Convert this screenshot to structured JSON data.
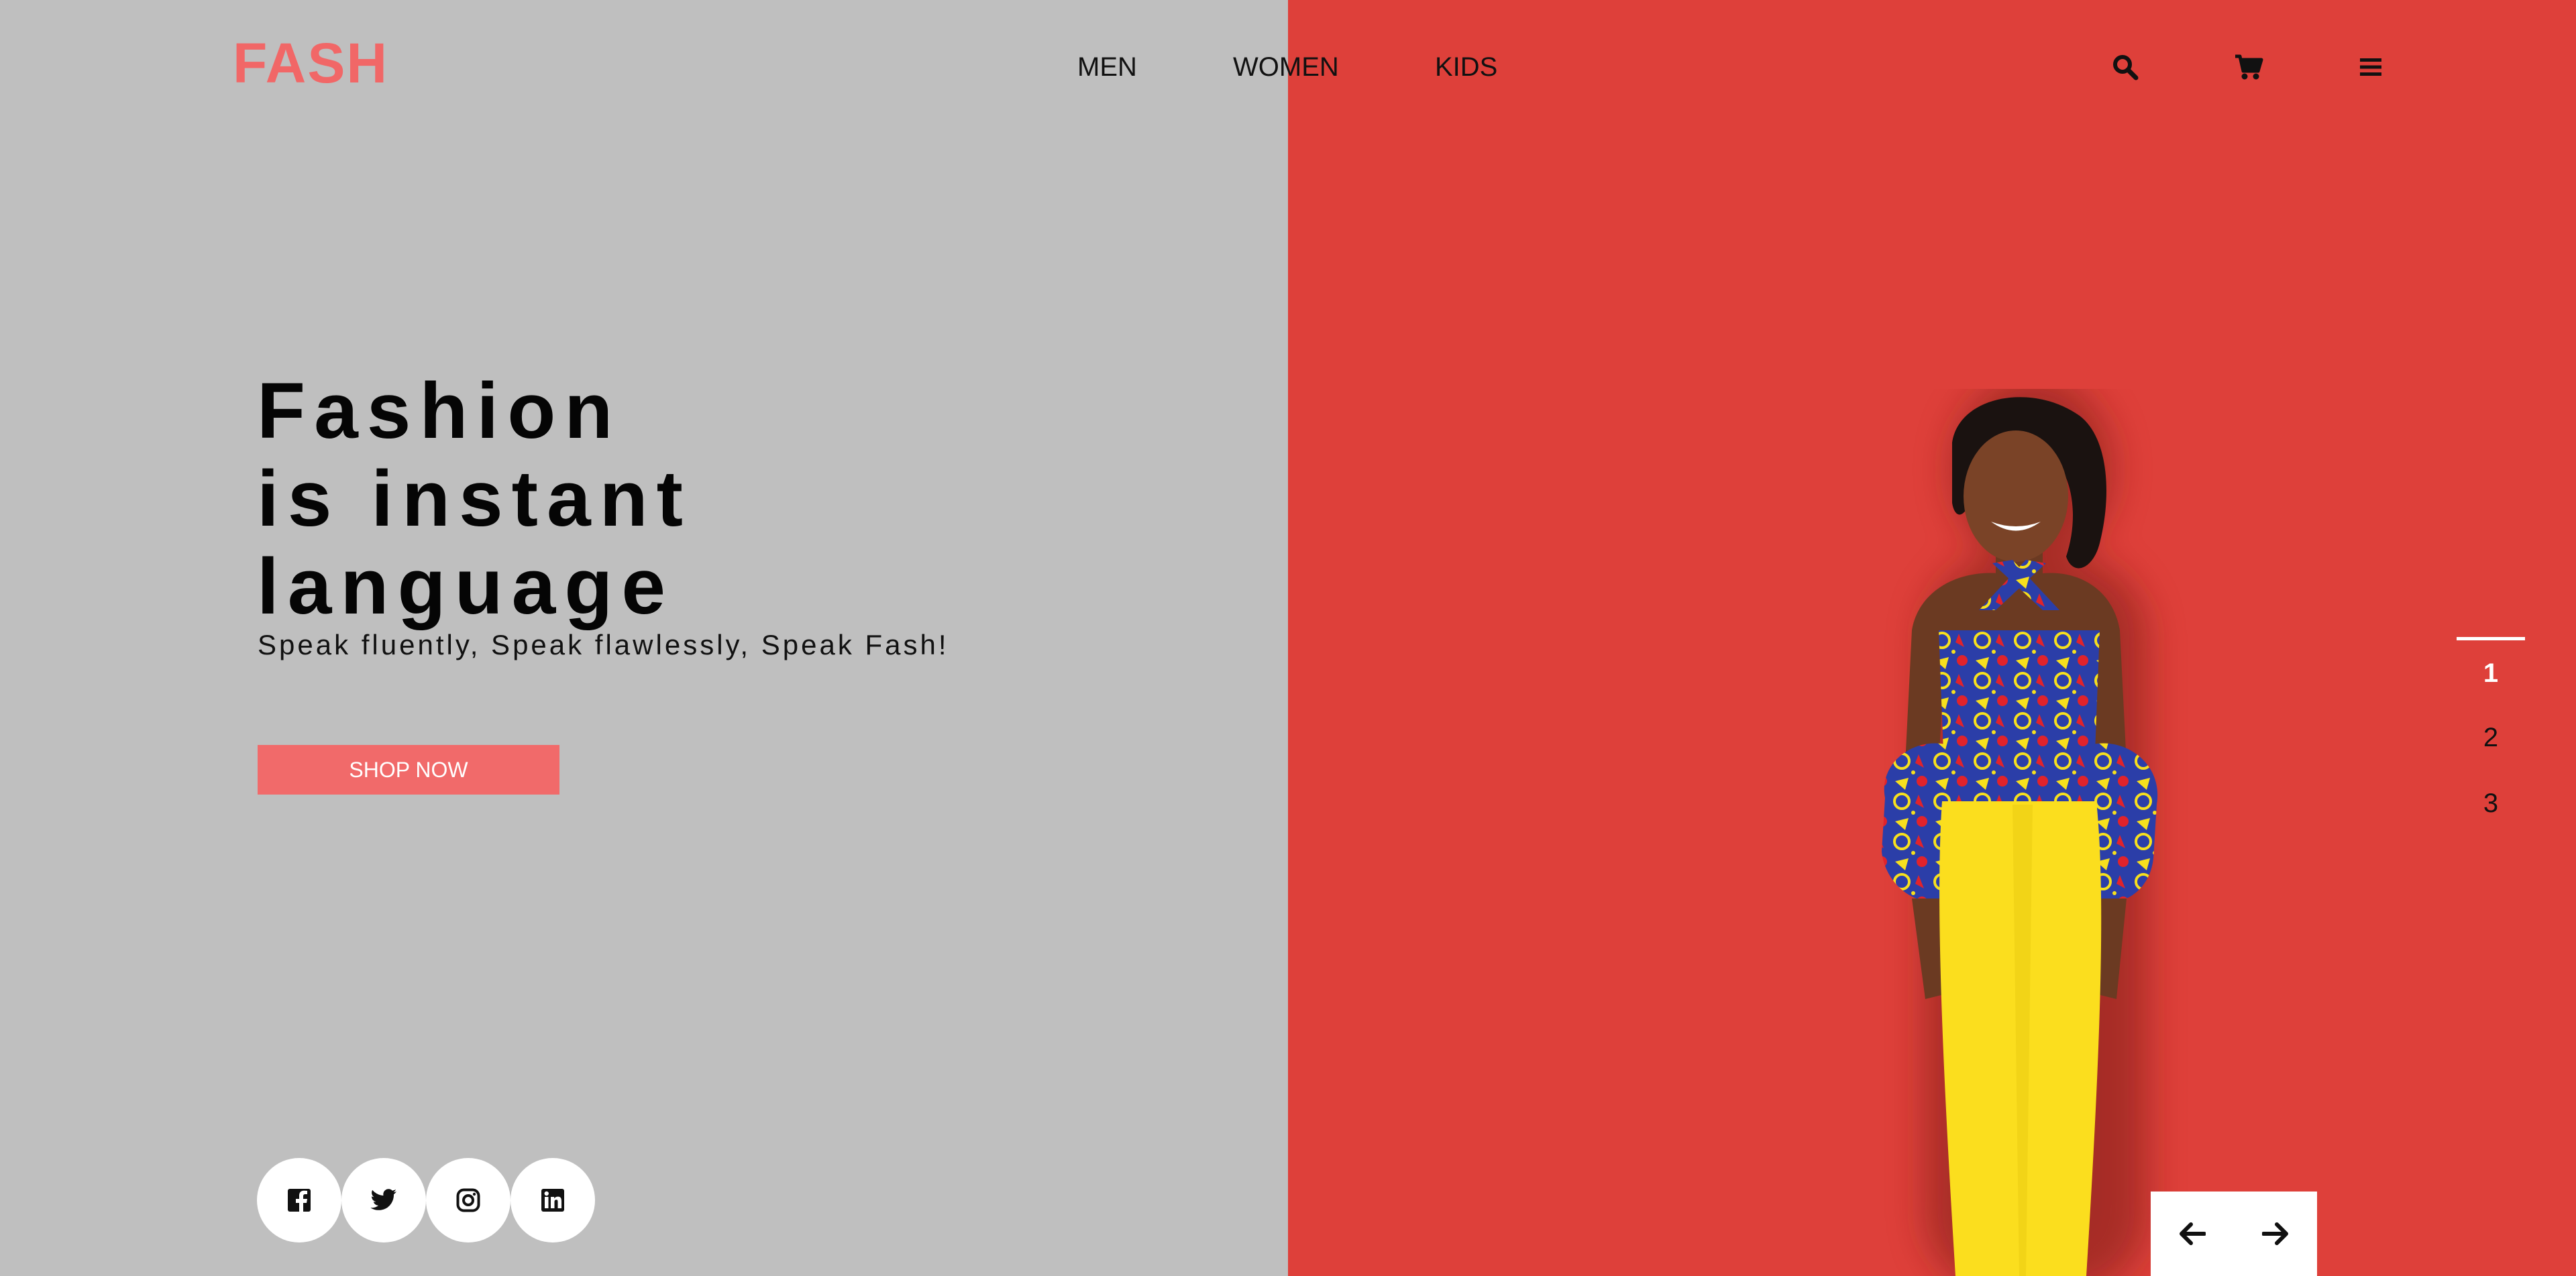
{
  "header": {
    "logo": "FASH",
    "nav": [
      {
        "label": "MEN"
      },
      {
        "label": "WOMEN"
      },
      {
        "label": "KIDS"
      }
    ],
    "icons": [
      "search-icon",
      "cart-icon",
      "menu-icon"
    ]
  },
  "hero": {
    "title_lines": [
      "Fashion",
      "is instant",
      "language"
    ],
    "subtitle": "Speak fluently, Speak flawlessly, Speak Fash!",
    "cta_label": "SHOP NOW"
  },
  "social": [
    "facebook-icon",
    "twitter-icon",
    "instagram-icon",
    "linkedin-icon"
  ],
  "slider": {
    "pages": [
      "1",
      "2",
      "3"
    ],
    "active": "1"
  },
  "colors": {
    "left_bg": "#bfbfbf",
    "right_bg": "#de403a",
    "accent": "#f16767"
  }
}
